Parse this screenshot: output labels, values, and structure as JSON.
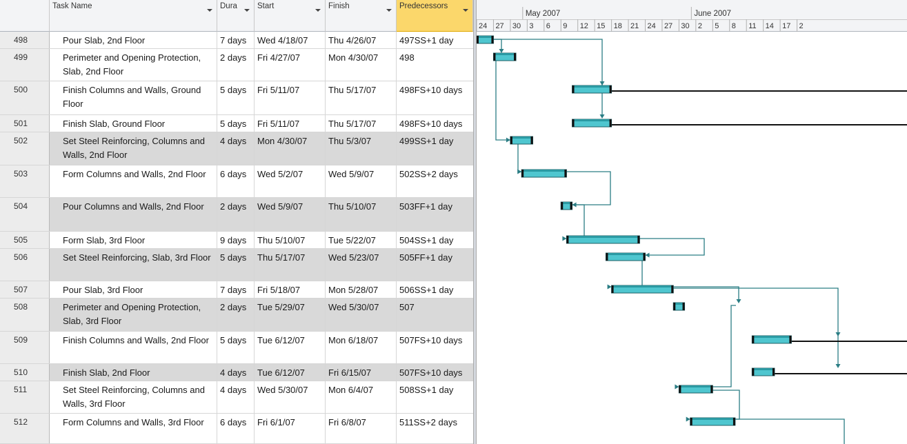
{
  "columns": {
    "name": "Task Name",
    "duration": "Dura",
    "start": "Start",
    "finish": "Finish",
    "predecessors": "Predecessors"
  },
  "timescale": {
    "months": [
      "May 2007",
      "June 2007"
    ],
    "days": [
      "24",
      "27",
      "30",
      "3",
      "6",
      "9",
      "12",
      "15",
      "18",
      "21",
      "24",
      "27",
      "30",
      "2",
      "5",
      "8",
      "11",
      "14",
      "17",
      "2"
    ]
  },
  "colors": {
    "bar_fill": "#4fc6cf",
    "bar_outline": "#1f5f66",
    "link": "#2a7d84",
    "selected_header": "#fbd76b"
  },
  "tasks": [
    {
      "id": "498",
      "name": "Pour Slab, 2nd Floor",
      "duration": "7 days",
      "start": "Wed 4/18/07",
      "finish": "Thu 4/26/07",
      "pred": "497SS+1 day",
      "shade": false
    },
    {
      "id": "499",
      "name": "Perimeter and Opening Protection, Slab, 2nd Floor",
      "duration": "2 days",
      "start": "Fri 4/27/07",
      "finish": "Mon 4/30/07",
      "pred": "498",
      "shade": false
    },
    {
      "id": "500",
      "name": "Finish Columns and Walls, Ground Floor",
      "duration": "5 days",
      "start": "Fri 5/11/07",
      "finish": "Thu 5/17/07",
      "pred": "498FS+10 days",
      "shade": false
    },
    {
      "id": "501",
      "name": "Finish Slab, Ground Floor",
      "duration": "5 days",
      "start": "Fri 5/11/07",
      "finish": "Thu 5/17/07",
      "pred": "498FS+10 days",
      "shade": false
    },
    {
      "id": "502",
      "name": "Set Steel Reinforcing, Columns and Walls, 2nd Floor",
      "duration": "4 days",
      "start": "Mon 4/30/07",
      "finish": "Thu 5/3/07",
      "pred": "499SS+1 day",
      "shade": true
    },
    {
      "id": "503",
      "name": "Form Columns and Walls, 2nd Floor",
      "duration": "6 days",
      "start": "Wed 5/2/07",
      "finish": "Wed 5/9/07",
      "pred": "502SS+2 days",
      "shade": false
    },
    {
      "id": "504",
      "name": "Pour Columns and Walls, 2nd Floor",
      "duration": "2 days",
      "start": "Wed 5/9/07",
      "finish": "Thu 5/10/07",
      "pred": "503FF+1 day",
      "shade": true
    },
    {
      "id": "505",
      "name": "Form Slab, 3rd Floor",
      "duration": "9 days",
      "start": "Thu 5/10/07",
      "finish": "Tue 5/22/07",
      "pred": "504SS+1 day",
      "shade": false
    },
    {
      "id": "506",
      "name": "Set Steel Reinforcing, Slab, 3rd Floor",
      "duration": "5 days",
      "start": "Thu 5/17/07",
      "finish": "Wed 5/23/07",
      "pred": "505FF+1 day",
      "shade": true
    },
    {
      "id": "507",
      "name": "Pour Slab, 3rd Floor",
      "duration": "7 days",
      "start": "Fri 5/18/07",
      "finish": "Mon 5/28/07",
      "pred": "506SS+1 day",
      "shade": false
    },
    {
      "id": "508",
      "name": "Perimeter and Opening Protection, Slab, 3rd Floor",
      "duration": "2 days",
      "start": "Tue 5/29/07",
      "finish": "Wed 5/30/07",
      "pred": "507",
      "shade": true
    },
    {
      "id": "509",
      "name": "Finish Columns and Walls, 2nd Floor",
      "duration": "5 days",
      "start": "Tue 6/12/07",
      "finish": "Mon 6/18/07",
      "pred": "507FS+10 days",
      "shade": false
    },
    {
      "id": "510",
      "name": "Finish Slab, 2nd Floor",
      "duration": "4 days",
      "start": "Tue 6/12/07",
      "finish": "Fri 6/15/07",
      "pred": "507FS+10 days",
      "shade": true
    },
    {
      "id": "511",
      "name": "Set Steel Reinforcing, Columns and Walls, 3rd Floor",
      "duration": "4 days",
      "start": "Wed 5/30/07",
      "finish": "Mon 6/4/07",
      "pred": "508SS+1 day",
      "shade": false
    },
    {
      "id": "512",
      "name": "Form Columns and Walls, 3rd Floor",
      "duration": "6 days",
      "start": "Fri 6/1/07",
      "finish": "Fri 6/8/07",
      "pred": "511SS+2 days",
      "shade": false
    }
  ]
}
